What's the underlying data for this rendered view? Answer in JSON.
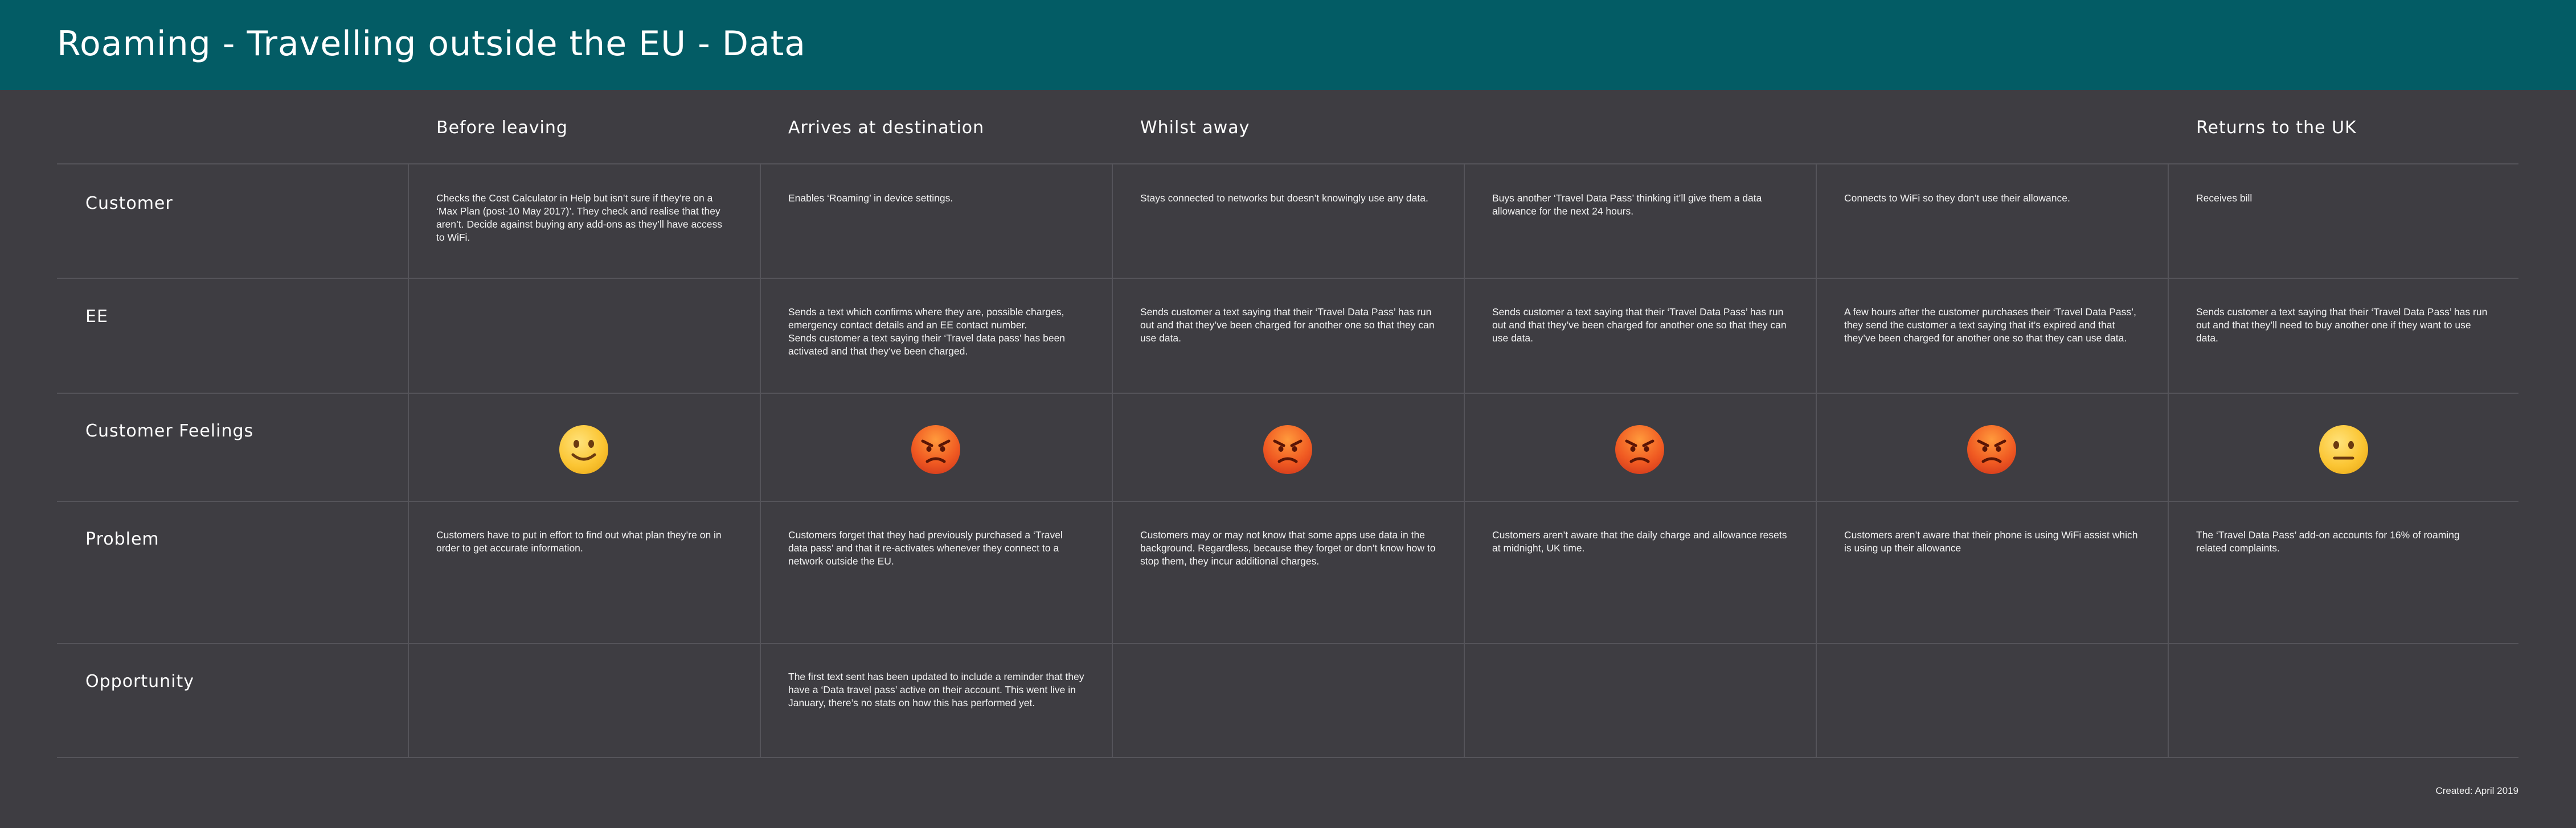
{
  "title": "Roaming - Travelling outside the EU - Data",
  "phases": [
    "Before leaving",
    "Arrives at destination",
    "Whilst away",
    "Returns to the UK"
  ],
  "rows": [
    {
      "label": "Customer",
      "cells": [
        "Checks the Cost Calculator in Help but isn’t sure if they’re on a ‘Max Plan (post-10 May 2017)’. They check and realise that they aren’t. Decide against buying any add-ons as they’ll have access to WiFi.",
        "Enables ‘Roaming’ in device settings.",
        "Stays connected to networks but doesn’t knowingly use any data.",
        "Buys another ‘Travel Data Pass’ thinking it’ll give them a data allowance for the next 24 hours.",
        "Connects to WiFi so they don’t use their allowance.",
        "Receives bill"
      ]
    },
    {
      "label": "EE",
      "cells": [
        "",
        "Sends a text which confirms where they are, possible charges, emergency contact details and an EE contact number.\nSends customer a text saying their ‘Travel data pass’ has been activated and that they’ve been charged.",
        "Sends customer a text saying that their ‘Travel Data Pass’ has run out and that they’ve been charged for another one so that they can use data.",
        "Sends customer a text saying that their ‘Travel Data Pass’ has run out and that they’ve been charged for another one so that they can use data.",
        "A few hours after the customer purchases their ‘Travel Data Pass’, they send the customer a text saying that it’s expired and that they’ve been charged for another one so that they can use data.",
        "Sends customer a text saying that their ‘Travel Data Pass’ has run out and that they’ll need to buy another one if they want to use data."
      ]
    },
    {
      "label": "Customer Feelings",
      "feelings": [
        "slightly-smiling-face-icon",
        "angry-face-icon",
        "angry-face-icon",
        "angry-face-icon",
        "angry-face-icon",
        "neutral-face-icon"
      ]
    },
    {
      "label": "Problem",
      "cells": [
        "Customers have to put in effort to find out what plan they’re on in order to get accurate information.",
        "Customers forget that they had previously purchased a ‘Travel data pass’ and that it re-activates whenever they connect to a network outside the EU.",
        "Customers may or may not know that some apps use data in the background. Regardless, because they forget or don’t know how to stop them, they incur additional charges.",
        "Customers aren’t aware that the daily charge and allowance resets at midnight, UK time.",
        "Customers aren’t aware that their phone is using WiFi assist which is using up their allowance",
        "The ‘Travel Data Pass’ add-on accounts for 16% of roaming related complaints."
      ]
    },
    {
      "label": "Opportunity",
      "cells": [
        "",
        "The first text sent has been updated to include a reminder that they have a ‘Data travel pass’ active on their account. This went live in January, there’s no stats on how this has performed yet.",
        "",
        "",
        "",
        ""
      ]
    }
  ],
  "footer": "Created: April 2019",
  "colors": {
    "header": "#035c65",
    "background": "#3e3d42",
    "divider": "#55545a"
  }
}
